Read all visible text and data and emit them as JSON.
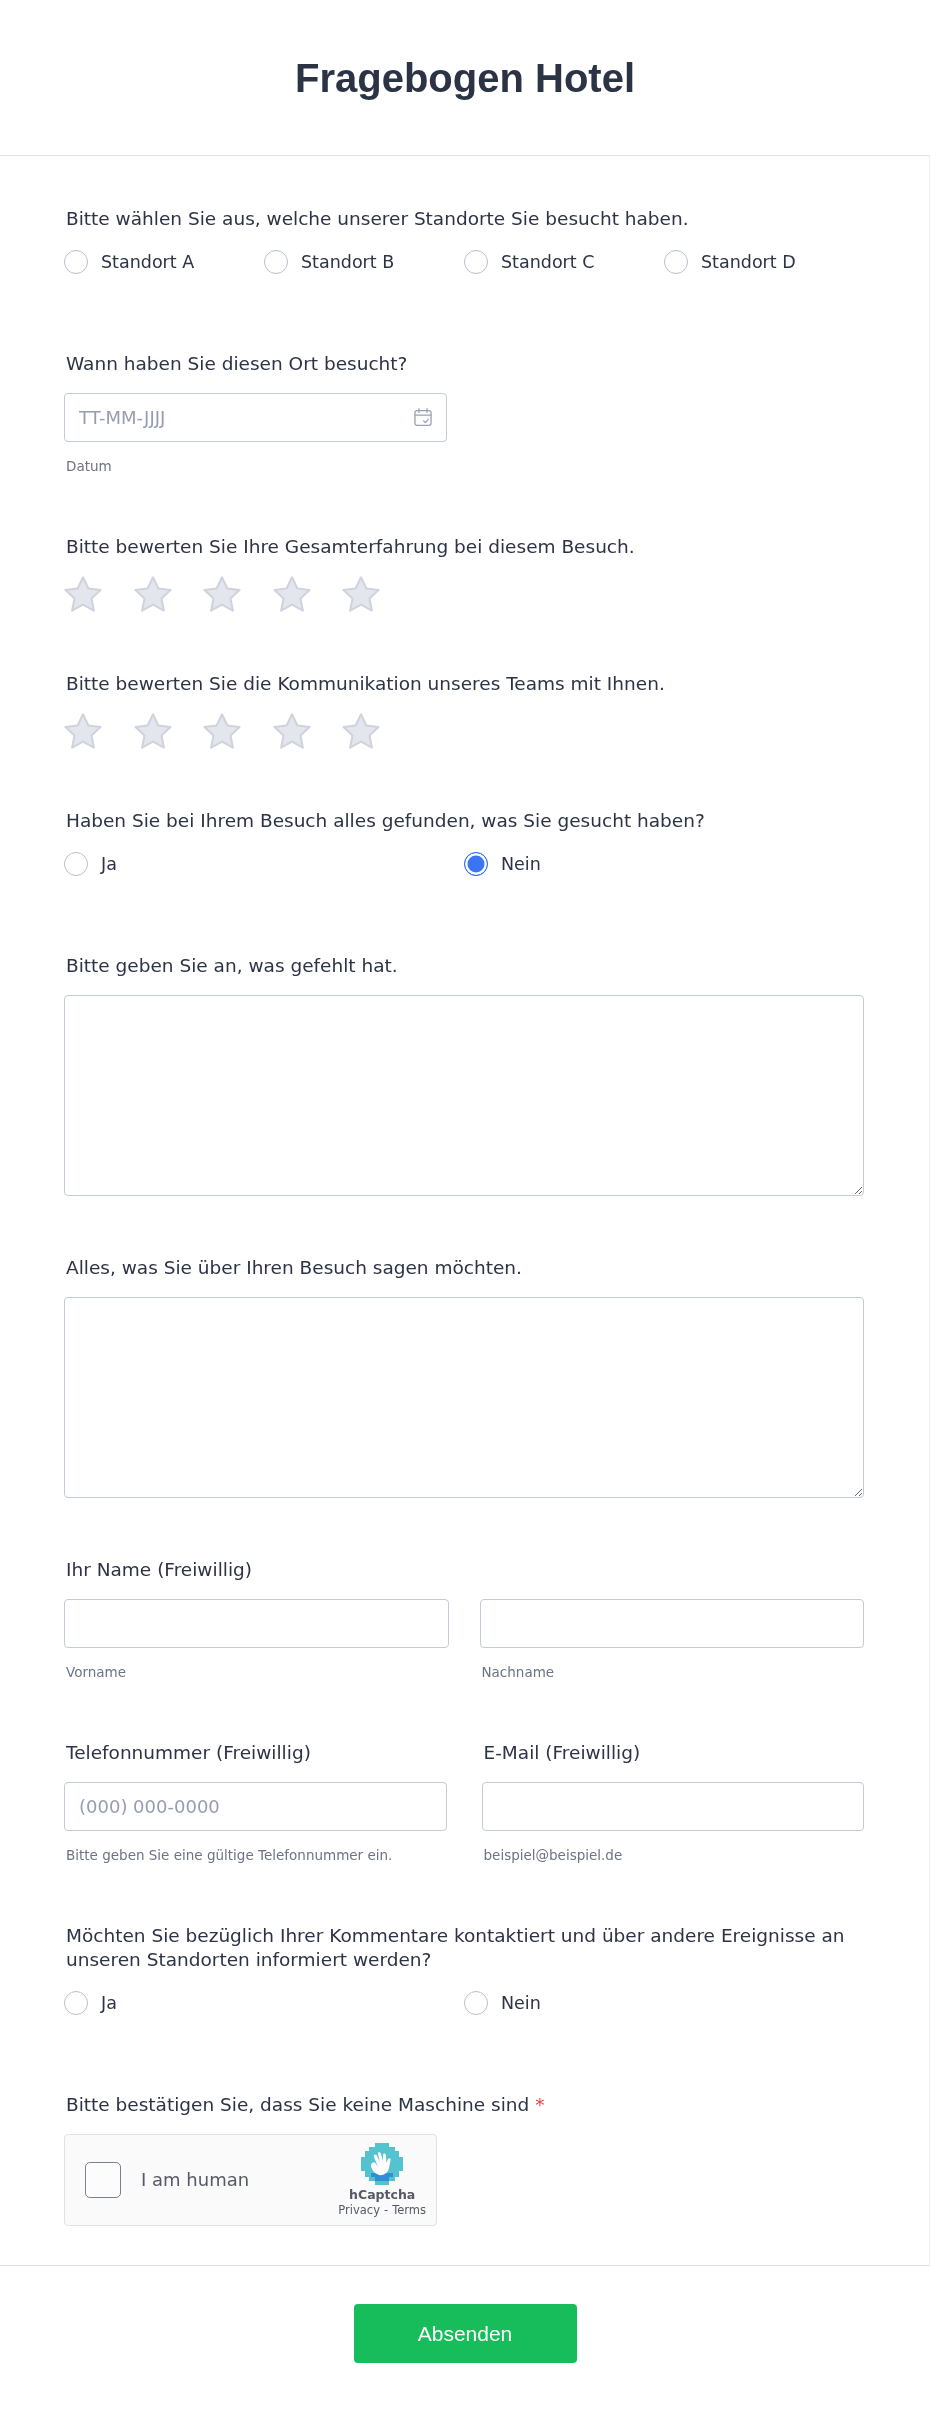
{
  "header": {
    "title": "Fragebogen Hotel"
  },
  "questions": [
    {
      "kind": "radio",
      "label": "Bitte wählen Sie aus, welche unserer Standorte Sie besucht haben.",
      "options": [
        {
          "label": "Standort A",
          "selected": false
        },
        {
          "label": "Standort B",
          "selected": false
        },
        {
          "label": "Standort C",
          "selected": false
        },
        {
          "label": "Standort D",
          "selected": false
        }
      ]
    },
    {
      "kind": "date",
      "label": "Wann haben Sie diesen Ort besucht?",
      "placeholder": "TT-MM-JJJJ",
      "sublabel": "Datum"
    },
    {
      "kind": "rating",
      "label": "Bitte bewerten Sie Ihre Gesamterfahrung bei diesem Besuch.",
      "stars": 0
    },
    {
      "kind": "rating",
      "label": "Bitte bewerten Sie die Kommunikation unseres Teams mit Ihnen.",
      "stars": 0
    },
    {
      "kind": "radio",
      "label": "Haben Sie bei Ihrem Besuch alles gefunden, was Sie gesucht haben?",
      "options": [
        {
          "label": "Ja",
          "selected": false
        },
        {
          "label": "Nein",
          "selected": true
        }
      ]
    },
    {
      "kind": "textarea",
      "label": "Bitte geben Sie an, was gefehlt hat."
    },
    {
      "kind": "textarea",
      "label": "Alles, was Sie über Ihren Besuch sagen möchten."
    },
    {
      "kind": "fullname",
      "label": "Ihr Name (Freiwillig)",
      "fields": [
        {
          "sublabel": "Vorname"
        },
        {
          "sublabel": "Nachname"
        }
      ]
    },
    {
      "kind": "pair",
      "fields": [
        {
          "label": "Telefonnummer (Freiwillig)",
          "placeholder": "(000) 000-0000",
          "sublabel": "Bitte geben Sie eine gültige Telefonnummer ein."
        },
        {
          "label": "E-Mail (Freiwillig)",
          "sublabel": "beispiel@beispiel.de"
        }
      ]
    },
    {
      "kind": "radio",
      "label": "Möchten Sie bezüglich Ihrer Kommentare kontaktiert und über andere Ereignisse an unseren Standorten informiert werden?",
      "options": [
        {
          "label": "Ja",
          "selected": false
        },
        {
          "label": "Nein",
          "selected": false
        }
      ]
    },
    {
      "kind": "captcha",
      "label": "Bitte bestätigen Sie, dass Sie keine Maschine sind",
      "required_mark": "*",
      "checkbox_label": "I am human",
      "checked": false,
      "brand": "hCaptcha",
      "links": [
        {
          "label": "Privacy"
        },
        {
          "label": "Terms"
        }
      ],
      "separator": "-"
    }
  ],
  "submit": {
    "label": "Absenden"
  }
}
